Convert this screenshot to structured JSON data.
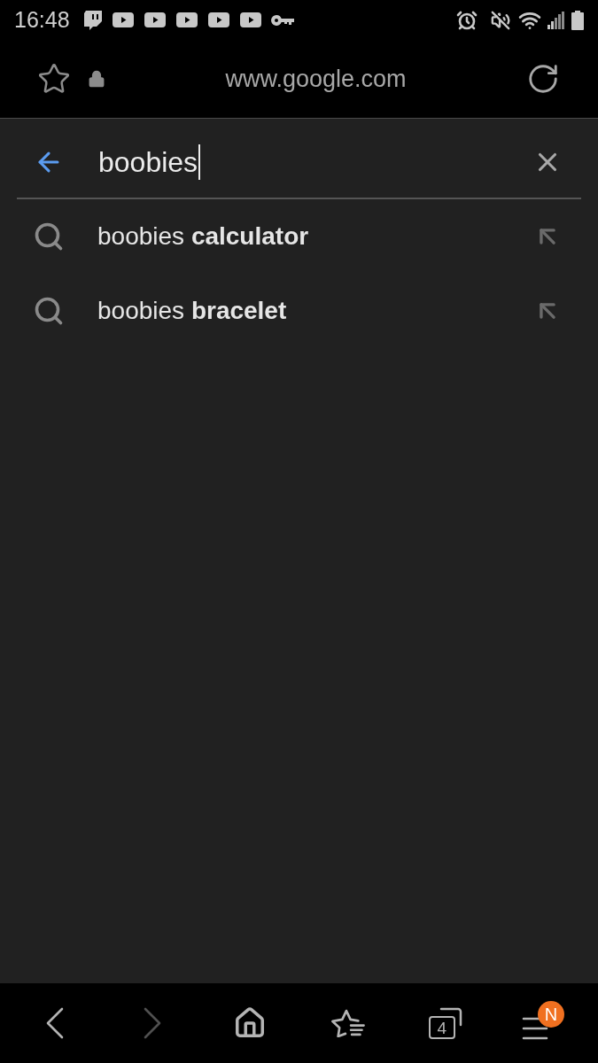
{
  "status_bar": {
    "time": "16:48"
  },
  "address_bar": {
    "url": "www.google.com"
  },
  "search": {
    "value": "boobies"
  },
  "suggestions": [
    {
      "text": "boobies **calculator**"
    },
    {
      "text": "boobies **bracelet**"
    }
  ],
  "bottom_bar": {
    "items": [
      {
        "kind": "back",
        "disabled": false
      },
      {
        "kind": "forward",
        "disabled": true
      },
      {
        "kind": "home",
        "disabled": false
      },
      {
        "kind": "bookmarks",
        "disabled": false
      },
      {
        "kind": "tabs",
        "disabled": false,
        "count": "4"
      },
      {
        "kind": "menu",
        "disabled": false,
        "badge": "N"
      }
    ]
  }
}
